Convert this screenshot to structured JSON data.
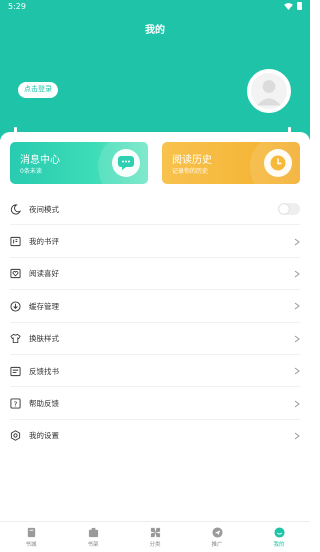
{
  "status": {
    "time": "5:29"
  },
  "header": {
    "title": "我的",
    "login_label": "点击登录"
  },
  "cards": [
    {
      "title": "消息中心",
      "subtitle": "0条未读",
      "icon": "chat-bubble-icon"
    },
    {
      "title": "阅读历史",
      "subtitle": "记录你的历史",
      "icon": "clock-icon"
    }
  ],
  "menu": [
    {
      "label": "夜间模式",
      "icon": "moon-icon",
      "control": "toggle"
    },
    {
      "label": "我的书评",
      "icon": "review-icon",
      "control": "chevron"
    },
    {
      "label": "阅读喜好",
      "icon": "heart-icon",
      "control": "chevron"
    },
    {
      "label": "缓存管理",
      "icon": "download-icon",
      "control": "chevron"
    },
    {
      "label": "换肤样式",
      "icon": "shirt-icon",
      "control": "chevron"
    },
    {
      "label": "反馈找书",
      "icon": "list-icon",
      "control": "chevron"
    },
    {
      "label": "帮助反馈",
      "icon": "help-icon",
      "control": "chevron"
    },
    {
      "label": "我的设置",
      "icon": "settings-icon",
      "control": "chevron"
    }
  ],
  "nav": [
    {
      "label": "书城",
      "icon": "book-icon"
    },
    {
      "label": "书架",
      "icon": "bookshelf-icon"
    },
    {
      "label": "分类",
      "icon": "category-icon"
    },
    {
      "label": "推广",
      "icon": "send-icon"
    },
    {
      "label": "我的",
      "icon": "profile-icon",
      "active": true
    }
  ],
  "colors": {
    "accent": "#1fc4a8",
    "history_card": "#f5b637"
  },
  "night_mode": false
}
